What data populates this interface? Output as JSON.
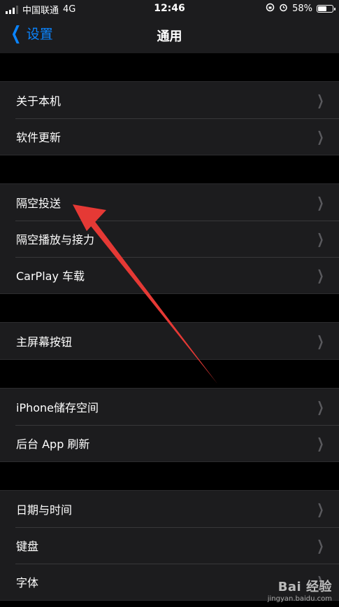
{
  "status_bar": {
    "carrier": "中国联通",
    "network": "4G",
    "time": "12:46",
    "battery": "58%",
    "battery_level": 0.58
  },
  "nav": {
    "back_label": "设置",
    "title": "通用"
  },
  "groups": [
    {
      "items": [
        {
          "label": "关于本机"
        },
        {
          "label": "软件更新"
        }
      ]
    },
    {
      "items": [
        {
          "label": "隔空投送"
        },
        {
          "label": "隔空播放与接力"
        },
        {
          "label": "CarPlay 车载"
        }
      ]
    },
    {
      "items": [
        {
          "label": "主屏幕按钮"
        }
      ]
    },
    {
      "items": [
        {
          "label": "iPhone储存空间"
        },
        {
          "label": "后台 App 刷新"
        }
      ]
    },
    {
      "items": [
        {
          "label": "日期与时间"
        },
        {
          "label": "键盘"
        },
        {
          "label": "字体"
        }
      ]
    }
  ],
  "annotation": {
    "color": "#e53935"
  },
  "watermark": {
    "logo": "Bai 经验",
    "sub": "jingyan.baidu.com"
  },
  "colors": {
    "accent": "#0a84ff",
    "cell_bg": "#1c1c1e",
    "background": "#000000"
  }
}
